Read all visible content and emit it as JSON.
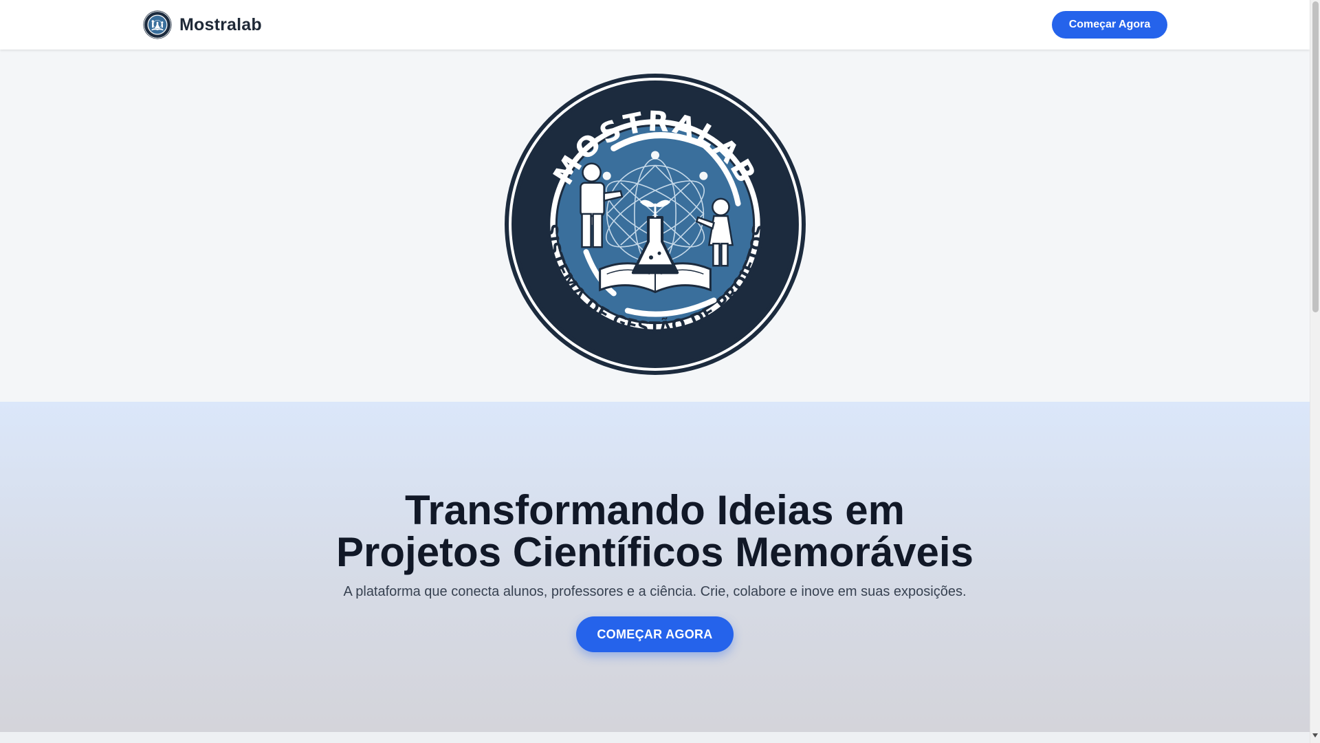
{
  "header": {
    "brand_name": "Mostralab",
    "cta_label": "Começar Agora"
  },
  "logo": {
    "top_text": "MOSTRALAB",
    "bottom_text": "SISTEMA DE GESTÃO DE PROJETOS",
    "colors": {
      "outer_ring": "#1c2b3e",
      "inner_disc": "#3a6f9c",
      "figure": "#ffffff"
    }
  },
  "hero": {
    "title_line1": "Transformando Ideias em",
    "title_line2": "Projetos Científicos Memoráveis",
    "subtitle": "A plataforma que conecta alunos, professores e a ciência. Crie, colabore e inove em suas exposições.",
    "cta_label": "COMEÇAR AGORA"
  },
  "colors": {
    "accent": "#2563eb",
    "title": "#111827",
    "subtitle": "#374151"
  }
}
